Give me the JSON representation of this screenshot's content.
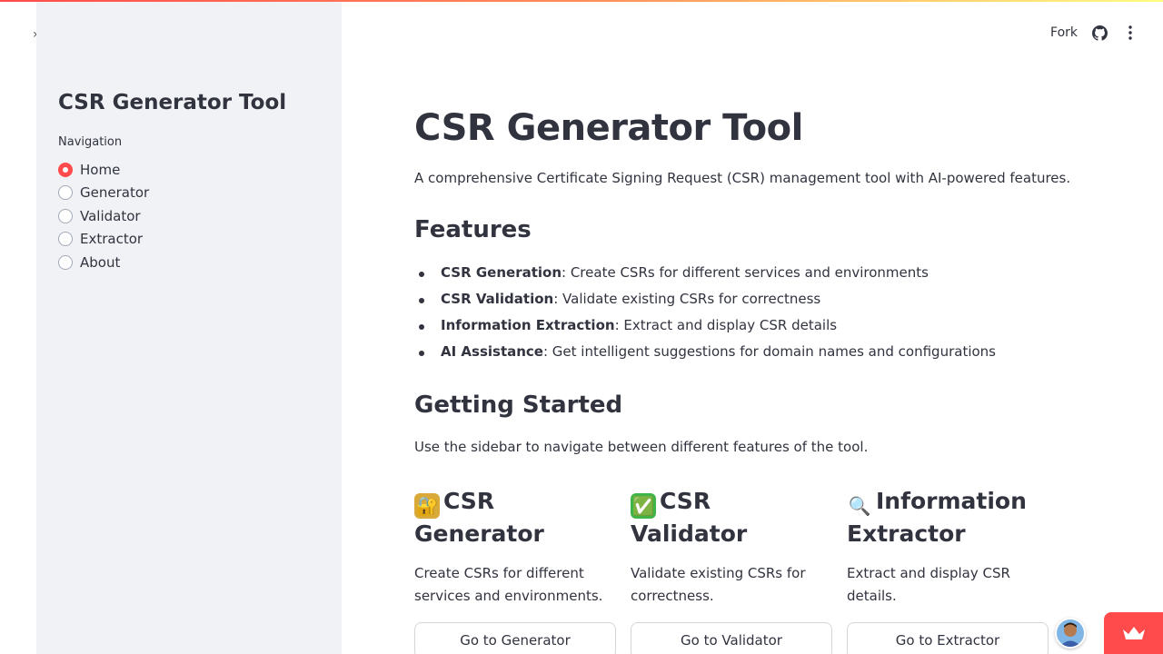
{
  "header": {
    "fork_label": "Fork",
    "github_icon": "github-icon",
    "menu_icon": "vertical-dots-icon",
    "accent_color": "#ff4b4b"
  },
  "sidebar": {
    "title": "CSR Generator Tool",
    "nav_label": "Navigation",
    "selected": "Home",
    "items": [
      {
        "label": "Home",
        "checked": true
      },
      {
        "label": "Generator",
        "checked": false
      },
      {
        "label": "Validator",
        "checked": false
      },
      {
        "label": "Extractor",
        "checked": false
      },
      {
        "label": "About",
        "checked": false
      }
    ]
  },
  "main": {
    "title": "CSR Generator Tool",
    "intro": "A comprehensive Certificate Signing Request (CSR) management tool with AI-powered features.",
    "features_heading": "Features",
    "features": [
      {
        "name": "CSR Generation",
        "desc": ": Create CSRs for different services and environments"
      },
      {
        "name": "CSR Validation",
        "desc": ": Validate existing CSRs for correctness"
      },
      {
        "name": "Information Extraction",
        "desc": ": Extract and display CSR details"
      },
      {
        "name": "AI Assistance",
        "desc": ": Get intelligent suggestions for domain names and configurations"
      }
    ],
    "getting_started_heading": "Getting Started",
    "getting_started_text": "Use the sidebar to navigate between different features of the tool.",
    "cards": [
      {
        "icon": "lock-with-key-icon",
        "emoji": "🔐",
        "title": "CSR Generator",
        "desc": "Create CSRs for different services and environments.",
        "button": "Go to Generator"
      },
      {
        "icon": "check-mark-icon",
        "emoji": "✅",
        "title": "CSR Validator",
        "desc": "Validate existing CSRs for correctness.",
        "button": "Go to Validator"
      },
      {
        "icon": "magnifying-glass-icon",
        "emoji": "🔍",
        "title": "Information Extractor",
        "desc": "Extract and display CSR details.",
        "button": "Go to Extractor"
      }
    ]
  }
}
